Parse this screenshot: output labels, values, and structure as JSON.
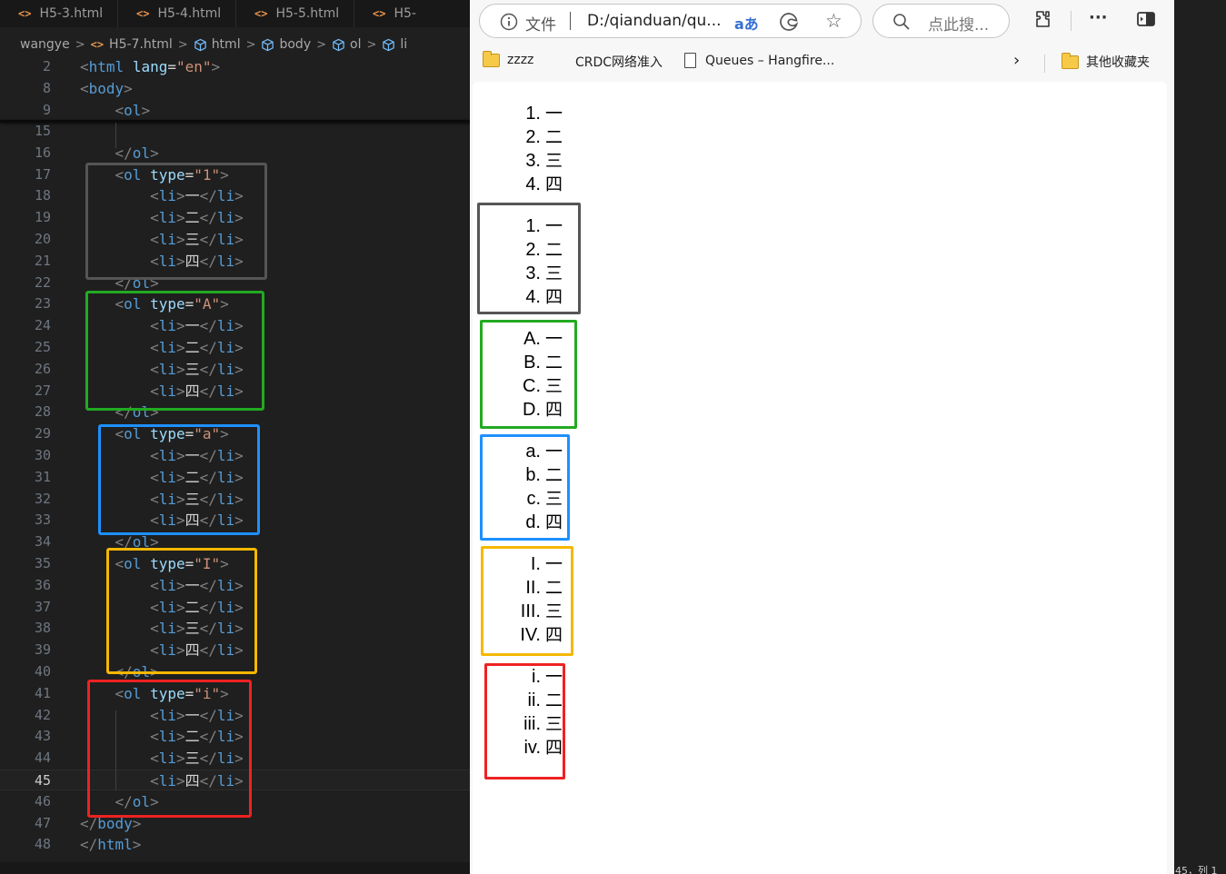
{
  "editor": {
    "tabs": [
      "H5-3.html",
      "H5-4.html",
      "H5-5.html",
      "H5-"
    ],
    "breadcrumb": [
      "wangye",
      "H5-7.html",
      "html",
      "body",
      "ol",
      "li"
    ],
    "sticky_lines": [
      {
        "n": "2",
        "indent": "",
        "kind": "html",
        "tag": "html",
        "attr": "lang",
        "val": "\"en\""
      },
      {
        "n": "8",
        "indent": "",
        "kind": "open",
        "tag": "body"
      },
      {
        "n": "9",
        "indent": "    ",
        "kind": "open",
        "tag": "ol"
      }
    ],
    "lines": [
      {
        "n": "15",
        "indent": "",
        "kind": "blank"
      },
      {
        "n": "16",
        "indent": "    ",
        "kind": "close",
        "tag": "ol"
      },
      {
        "n": "17",
        "indent": "    ",
        "kind": "oltype",
        "tag": "ol",
        "attr": "type",
        "val": "\"1\""
      },
      {
        "n": "18",
        "indent": "        ",
        "kind": "li",
        "text": "一"
      },
      {
        "n": "19",
        "indent": "        ",
        "kind": "li",
        "text": "二"
      },
      {
        "n": "20",
        "indent": "        ",
        "kind": "li",
        "text": "三"
      },
      {
        "n": "21",
        "indent": "        ",
        "kind": "li",
        "text": "四"
      },
      {
        "n": "22",
        "indent": "    ",
        "kind": "close",
        "tag": "ol"
      },
      {
        "n": "23",
        "indent": "    ",
        "kind": "oltype",
        "tag": "ol",
        "attr": "type",
        "val": "\"A\""
      },
      {
        "n": "24",
        "indent": "        ",
        "kind": "li",
        "text": "一"
      },
      {
        "n": "25",
        "indent": "        ",
        "kind": "li",
        "text": "二"
      },
      {
        "n": "26",
        "indent": "        ",
        "kind": "li",
        "text": "三"
      },
      {
        "n": "27",
        "indent": "        ",
        "kind": "li",
        "text": "四"
      },
      {
        "n": "28",
        "indent": "    ",
        "kind": "close",
        "tag": "ol"
      },
      {
        "n": "29",
        "indent": "    ",
        "kind": "oltype",
        "tag": "ol",
        "attr": "type",
        "val": "\"a\""
      },
      {
        "n": "30",
        "indent": "        ",
        "kind": "li",
        "text": "一"
      },
      {
        "n": "31",
        "indent": "        ",
        "kind": "li",
        "text": "二"
      },
      {
        "n": "32",
        "indent": "        ",
        "kind": "li",
        "text": "三"
      },
      {
        "n": "33",
        "indent": "        ",
        "kind": "li",
        "text": "四"
      },
      {
        "n": "34",
        "indent": "    ",
        "kind": "close",
        "tag": "ol"
      },
      {
        "n": "35",
        "indent": "    ",
        "kind": "oltype",
        "tag": "ol",
        "attr": "type",
        "val": "\"I\""
      },
      {
        "n": "36",
        "indent": "        ",
        "kind": "li",
        "text": "一"
      },
      {
        "n": "37",
        "indent": "        ",
        "kind": "li",
        "text": "二"
      },
      {
        "n": "38",
        "indent": "        ",
        "kind": "li",
        "text": "三"
      },
      {
        "n": "39",
        "indent": "        ",
        "kind": "li",
        "text": "四"
      },
      {
        "n": "40",
        "indent": "    ",
        "kind": "close",
        "tag": "ol"
      },
      {
        "n": "41",
        "indent": "    ",
        "kind": "oltype",
        "tag": "ol",
        "attr": "type",
        "val": "\"i\""
      },
      {
        "n": "42",
        "indent": "        ",
        "kind": "li",
        "text": "一"
      },
      {
        "n": "43",
        "indent": "        ",
        "kind": "li",
        "text": "二"
      },
      {
        "n": "44",
        "indent": "        ",
        "kind": "li",
        "text": "三"
      },
      {
        "n": "45",
        "indent": "        ",
        "kind": "li",
        "text": "四",
        "current": true
      },
      {
        "n": "46",
        "indent": "    ",
        "kind": "close",
        "tag": "ol"
      },
      {
        "n": "47",
        "indent": "",
        "kind": "close",
        "tag": "body"
      },
      {
        "n": "48",
        "indent": "",
        "kind": "close",
        "tag": "html"
      }
    ],
    "status_fragment": "45，列 1",
    "colors": {
      "gray": "#555555",
      "green": "#22aa22",
      "blue": "#1e90ff",
      "yellow": "#f5b800",
      "red": "#ee2222"
    }
  },
  "browser": {
    "address": {
      "protocol_label": "文件",
      "url": "D:/qianduan/qu..."
    },
    "search_placeholder": "点此搜...",
    "bookmarks": [
      "zzzz",
      "CRDC网络准入",
      "Queues – Hangfire...",
      "其他收藏夹"
    ],
    "lists": [
      {
        "markers": [
          "1.",
          "2.",
          "3.",
          "4."
        ],
        "items": [
          "一",
          "二",
          "三",
          "四"
        ],
        "color": ""
      },
      {
        "markers": [
          "1.",
          "2.",
          "3.",
          "4."
        ],
        "items": [
          "一",
          "二",
          "三",
          "四"
        ],
        "color": "#555555"
      },
      {
        "markers": [
          "A.",
          "B.",
          "C.",
          "D."
        ],
        "items": [
          "一",
          "二",
          "三",
          "四"
        ],
        "color": "#22aa22"
      },
      {
        "markers": [
          "a.",
          "b.",
          "c.",
          "d."
        ],
        "items": [
          "一",
          "二",
          "三",
          "四"
        ],
        "color": "#1e90ff"
      },
      {
        "markers": [
          "I.",
          "II.",
          "III.",
          "IV."
        ],
        "items": [
          "一",
          "二",
          "三",
          "四"
        ],
        "color": "#f5b800"
      },
      {
        "markers": [
          "i.",
          "ii.",
          "iii.",
          "iv."
        ],
        "items": [
          "一",
          "二",
          "三",
          "四"
        ],
        "color": "#ee2222"
      }
    ]
  }
}
